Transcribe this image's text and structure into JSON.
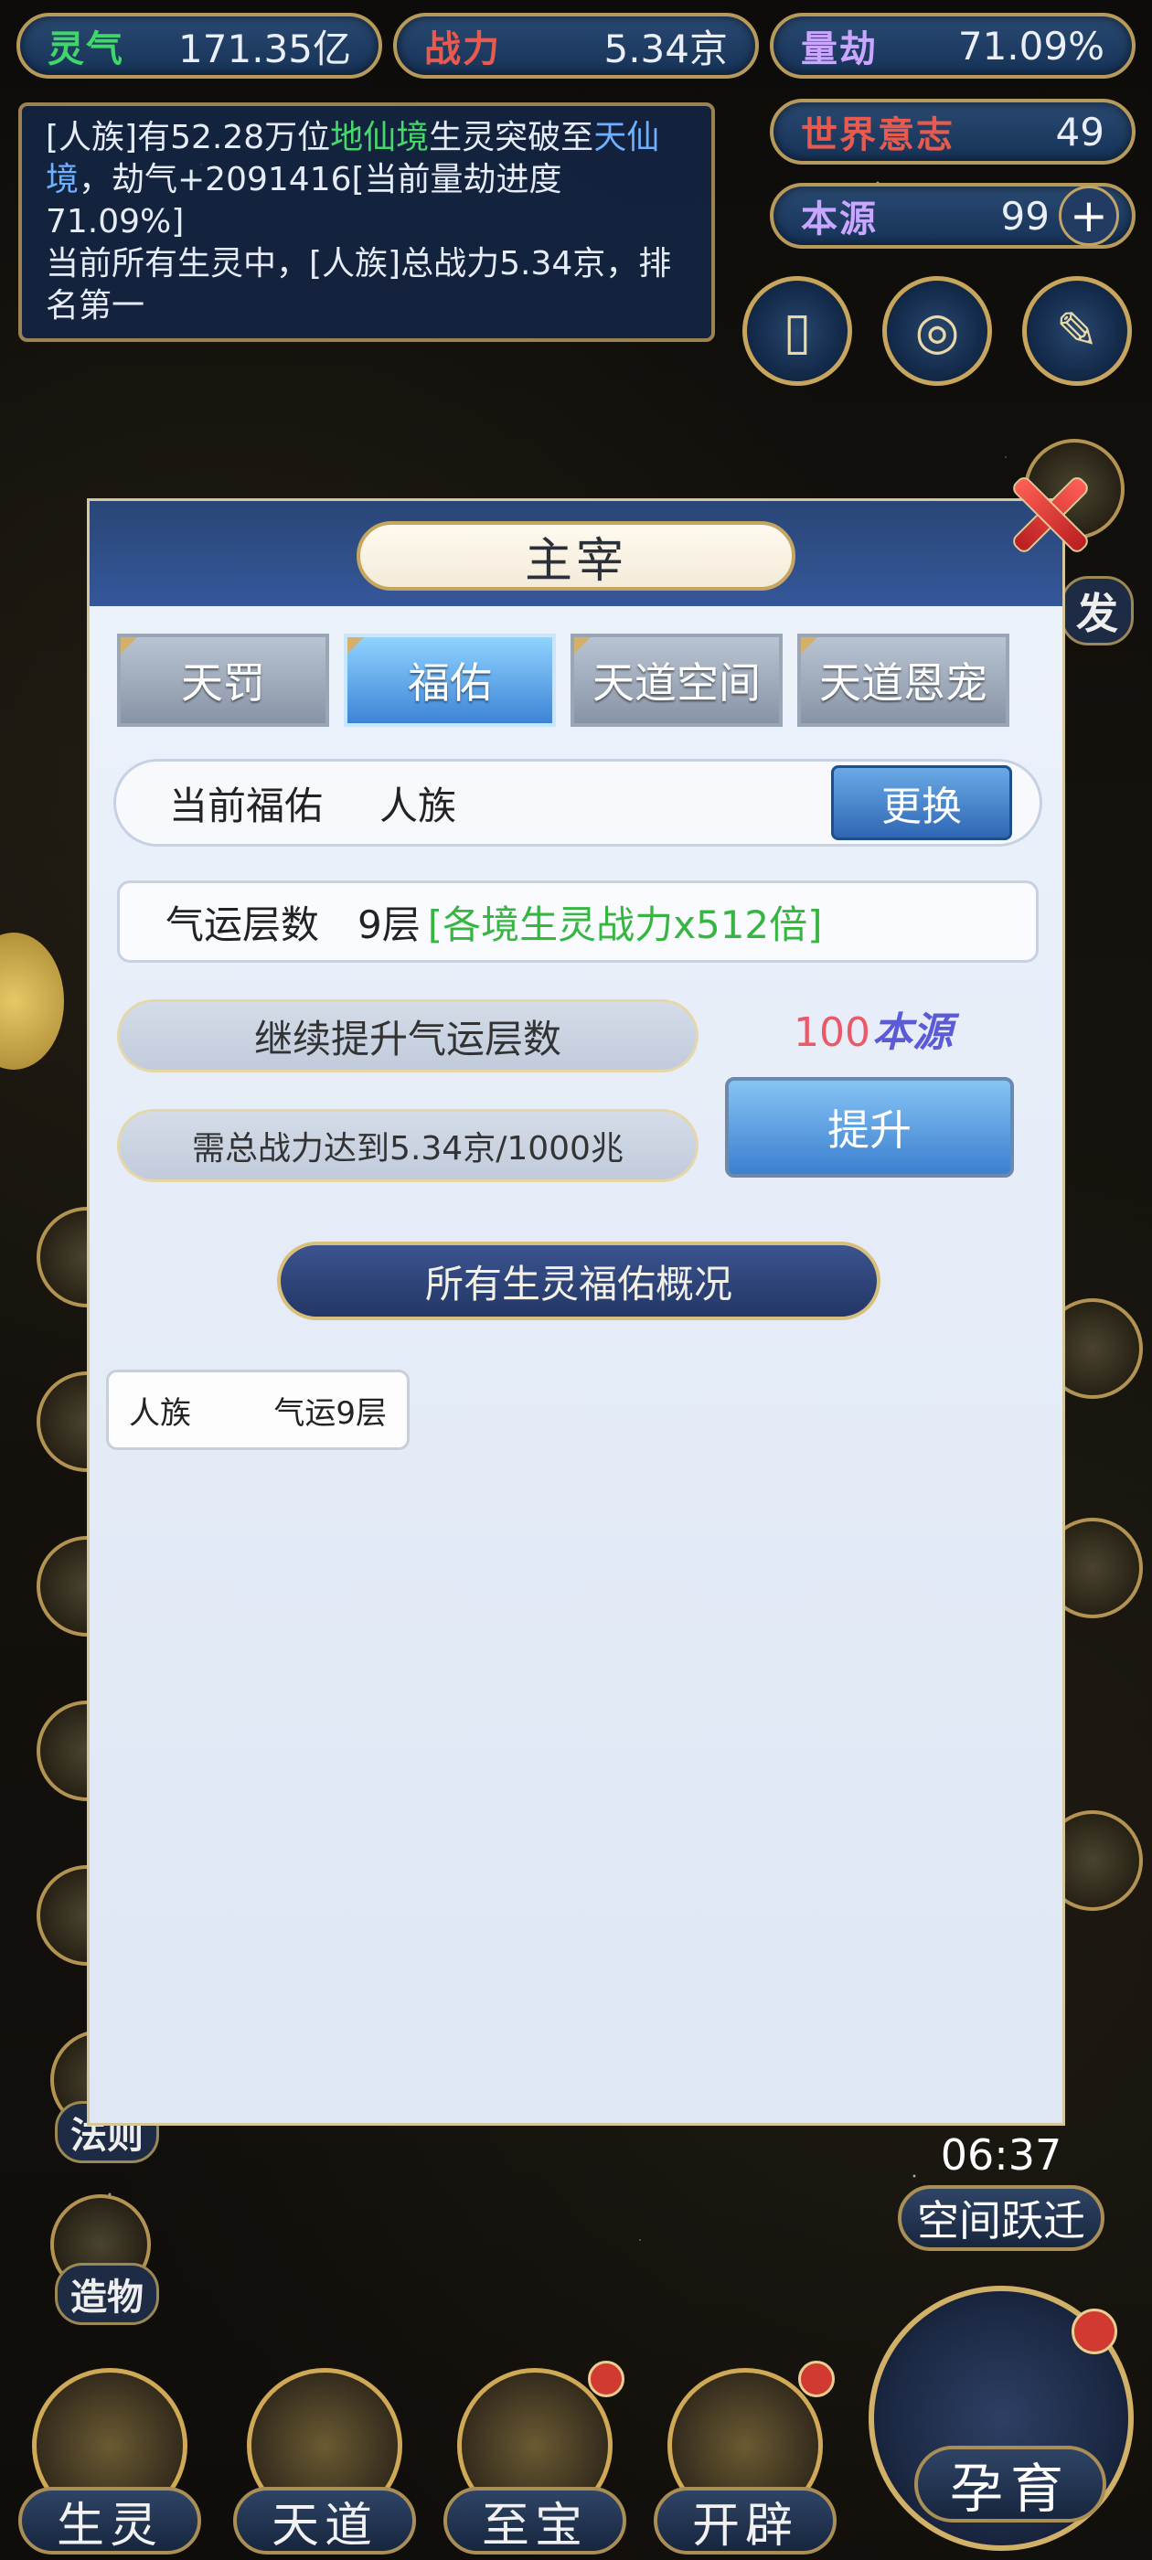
{
  "top_stats": {
    "lingqi": {
      "label": "灵气",
      "value": "171.35亿"
    },
    "zhanli": {
      "label": "战力",
      "value": "5.34京"
    },
    "liangjie": {
      "label": "量劫",
      "value": "71.09%"
    },
    "shijie": {
      "label": "世界意志",
      "value": "49"
    },
    "benyuan": {
      "label": "本源",
      "value": "99"
    }
  },
  "message": {
    "line1_prefix": "[人族]有52.28万位",
    "line1_realm": "地仙境",
    "line1_mid": "生灵突破至",
    "line1_target": "天仙境",
    "line1_suffix": "，劫气+2091416[当前量劫进度71.09%]",
    "line2": "当前所有生灵中，[人族]总战力5.34京，排名第一"
  },
  "dialog": {
    "title": "主宰",
    "tabs": [
      "天罚",
      "福佑",
      "天道空间",
      "天道恩宠"
    ],
    "current_blessing_label": "当前福佑",
    "current_blessing_value": "人族",
    "change_button": "更换",
    "luck_label": "气运层数",
    "luck_value": "9层",
    "luck_bonus": "[各境生灵战力x512倍]",
    "continue_label": "继续提升气运层数",
    "requirement_label": "需总战力达到5.34京/1000兆",
    "cost_number": "100",
    "cost_unit": "本源",
    "raise_button": "提升",
    "overview_banner": "所有生灵福佑概况",
    "race_card_name": "人族",
    "race_card_level": "气运9层"
  },
  "side_labels": [
    "法则",
    "造物",
    "发"
  ],
  "timer": "06:37",
  "space_jump_label": "空间跃迁",
  "bottom_nav": [
    "生灵",
    "天道",
    "至宝",
    "开辟"
  ],
  "incubate_label": "孕育"
}
